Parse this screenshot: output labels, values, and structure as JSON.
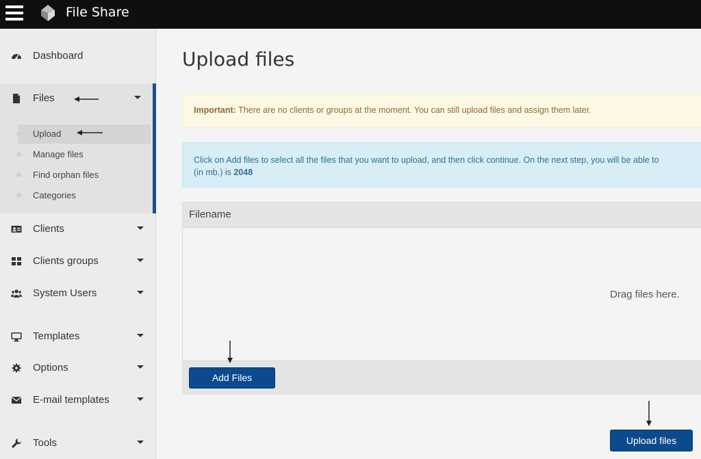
{
  "app": {
    "title": "File Share"
  },
  "sidebar": {
    "items": [
      {
        "label": "Dashboard",
        "icon": "dashboard-icon"
      },
      {
        "label": "Files",
        "icon": "file-icon"
      },
      {
        "label": "Clients",
        "icon": "id-card-icon"
      },
      {
        "label": "Clients groups",
        "icon": "grid-icon"
      },
      {
        "label": "System Users",
        "icon": "users-icon"
      },
      {
        "label": "Templates",
        "icon": "monitor-icon"
      },
      {
        "label": "Options",
        "icon": "gear-icon"
      },
      {
        "label": "E-mail templates",
        "icon": "envelope-icon"
      },
      {
        "label": "Tools",
        "icon": "wrench-icon"
      }
    ],
    "files_sub": [
      "Upload",
      "Manage files",
      "Find orphan files",
      "Categories"
    ]
  },
  "main": {
    "title": "Upload files",
    "warning_strong": "Important:",
    "warning_text": " There are no clients or groups at the moment. You can still upload files and assign them later.",
    "info_text_1": "Click on Add files to select all the files that you want to upload, and then click continue. On the next step, you will be able to",
    "info_text_2": "(in mb.) is ",
    "info_max": "2048",
    "uploader": {
      "column": "Filename",
      "drop_text": "Drag files here.",
      "add_button": "Add Files"
    },
    "upload_button": "Upload files"
  },
  "colors": {
    "topbar": "#0f0f12",
    "accent": "#1a4f8c",
    "button": "#0b4a8c"
  }
}
